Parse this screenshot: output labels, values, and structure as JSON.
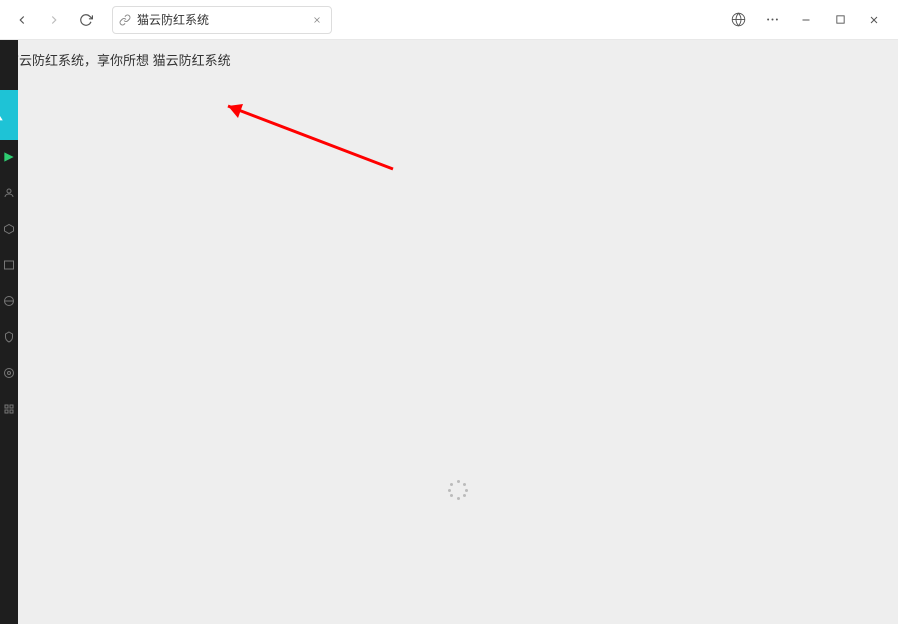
{
  "toolbar": {
    "address_text": "猫云防红系统"
  },
  "page": {
    "body_text": "猫云防红系统，享你所想 猫云防红系统"
  }
}
